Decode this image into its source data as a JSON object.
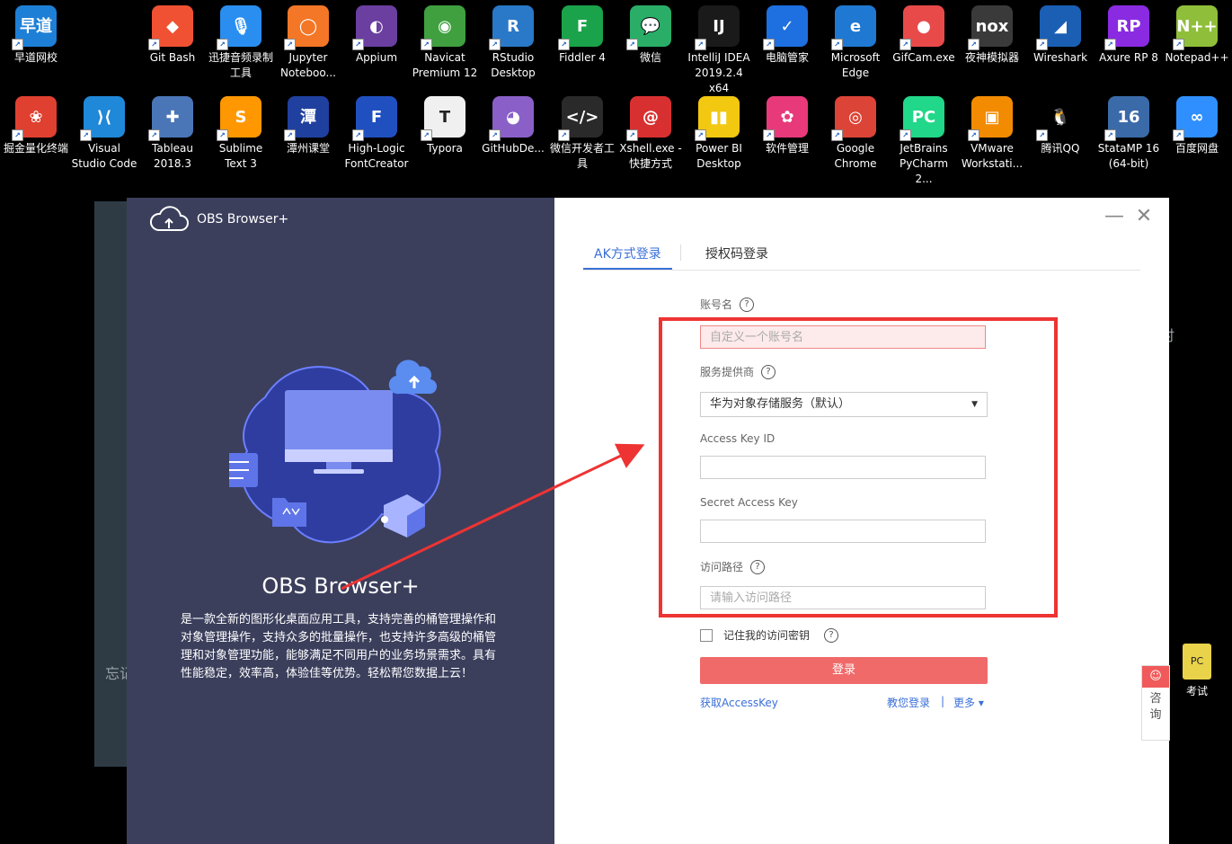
{
  "desktop": {
    "row1": [
      {
        "label": "早道网校",
        "glyph": "早道",
        "color": "#1e7fd6"
      },
      {
        "label": "Git Bash",
        "glyph": "◆",
        "color": "#f05133"
      },
      {
        "label": "迅捷音频录制工具",
        "glyph": "🎙",
        "color": "#2a8ef0"
      },
      {
        "label": "Jupyter Noteboo...",
        "glyph": "◯",
        "color": "#f37726"
      },
      {
        "label": "Appium",
        "glyph": "◐",
        "color": "#6a3fa0"
      },
      {
        "label": "Navicat Premium 12",
        "glyph": "◉",
        "color": "#40a040"
      },
      {
        "label": "RStudio Desktop",
        "glyph": "R",
        "color": "#2a78c8"
      },
      {
        "label": "Fiddler 4",
        "glyph": "F",
        "color": "#1aa34a"
      },
      {
        "label": "微信",
        "glyph": "💬",
        "color": "#2aae67"
      },
      {
        "label": "IntelliJ IDEA 2019.2.4 x64",
        "glyph": "IJ",
        "color": "#1a1a1a"
      },
      {
        "label": "电脑管家",
        "glyph": "✓",
        "color": "#1e6fe0"
      },
      {
        "label": "Microsoft Edge",
        "glyph": "e",
        "color": "#1f78d1"
      },
      {
        "label": "GifCam.exe",
        "glyph": "●",
        "color": "#e84a4a"
      },
      {
        "label": "夜神模拟器",
        "glyph": "nox",
        "color": "#3a3a3a"
      },
      {
        "label": "Wireshark",
        "glyph": "◢",
        "color": "#1a5fb4"
      },
      {
        "label": "Axure RP 8",
        "glyph": "RP",
        "color": "#8a2be2"
      },
      {
        "label": "Notepad++",
        "glyph": "N++",
        "color": "#8fbf3a"
      }
    ],
    "row2": [
      {
        "label": "掘金量化终端",
        "glyph": "❀",
        "color": "#e04030"
      },
      {
        "label": "Visual Studio Code",
        "glyph": "⟩⟨",
        "color": "#1f88d8"
      },
      {
        "label": "Tableau 2018.3",
        "glyph": "✚",
        "color": "#4a76b8"
      },
      {
        "label": "Sublime Text 3",
        "glyph": "S",
        "color": "#ff9800"
      },
      {
        "label": "潭州课堂",
        "glyph": "潭",
        "color": "#2040a0"
      },
      {
        "label": "High-Logic FontCreator",
        "glyph": "F",
        "color": "#2050c0"
      },
      {
        "label": "Typora",
        "glyph": "T",
        "color": "#f0f0f0"
      },
      {
        "label": "GitHubDe...",
        "glyph": "◕",
        "color": "#8a60c8"
      },
      {
        "label": "微信开发者工具",
        "glyph": "</>",
        "color": "#2a2a2a"
      },
      {
        "label": "Xshell.exe - 快捷方式",
        "glyph": "@",
        "color": "#d83030"
      },
      {
        "label": "Power BI Desktop",
        "glyph": "▮▮",
        "color": "#f2c811"
      },
      {
        "label": "软件管理",
        "glyph": "✿",
        "color": "#e83a7a"
      },
      {
        "label": "Google Chrome",
        "glyph": "◎",
        "color": "#db4437"
      },
      {
        "label": "JetBrains PyCharm 2...",
        "glyph": "PC",
        "color": "#21d789"
      },
      {
        "label": "VMware Workstati...",
        "glyph": "▣",
        "color": "#f38b00"
      },
      {
        "label": "腾讯QQ",
        "glyph": "🐧",
        "color": "#000000"
      },
      {
        "label": "StataMP 16 (64-bit)",
        "glyph": "16",
        "color": "#3a6aa8"
      },
      {
        "label": "百度网盘",
        "glyph": "∞",
        "color": "#2f8fff"
      }
    ]
  },
  "background_app": {
    "text_left": "忘记",
    "text_right": "时"
  },
  "dialog": {
    "app_name": "OBS Browser+",
    "title": "OBS Browser+",
    "description": "是一款全新的图形化桌面应用工具，支持完善的桶管理操作和对象管理操作，支持众多的批量操作，也支持许多高级的桶管理和对象管理功能，能够满足不同用户的业务场景需求。具有性能稳定，效率高，体验佳等优势。轻松帮您数据上云！",
    "min_glyph": "—",
    "close_glyph": "✕",
    "tabs": [
      {
        "label": "AK方式登录",
        "active": true
      },
      {
        "label": "授权码登录",
        "active": false
      }
    ],
    "form": {
      "account_label": "账号名",
      "account_placeholder": "自定义一个账号名",
      "provider_label": "服务提供商",
      "provider_value": "华为对象存储服务（默认）",
      "ak_label": "Access Key ID",
      "ak_value": "",
      "sk_label": "Secret Access Key",
      "sk_value": "",
      "path_label": "访问路径",
      "path_placeholder": "请输入访问路径",
      "remember_label": "记住我的访问密钥",
      "login_label": "登录",
      "get_ak_label": "获取AccessKey",
      "teach_label": "教您登录",
      "separator": "|",
      "more_label": "更多 ▾",
      "help_glyph": "?"
    }
  },
  "side_widgets": {
    "consult_label": "咨询",
    "chat_glyph": "☺",
    "exam_label": "考试",
    "exam_glyph": "PC"
  },
  "annotation": {
    "box_color": "#ee3333"
  }
}
